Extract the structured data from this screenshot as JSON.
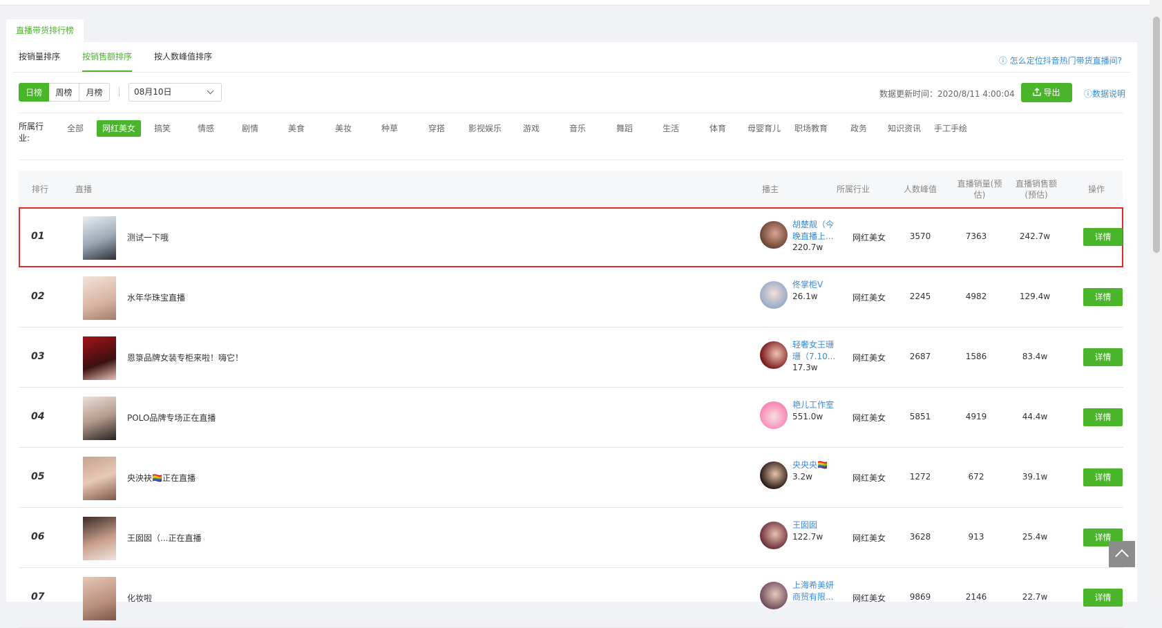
{
  "page_tab": "直播带货排行榜",
  "sort_tabs": [
    "按销量排序",
    "按销售额排序",
    "按人数峰值排序"
  ],
  "help_link": "ⓘ 怎么定位抖音热门带货直播间?",
  "period_buttons": [
    "日榜",
    "周榜",
    "月榜"
  ],
  "date_value": "08月10日",
  "update_time": "数据更新时间：2020/8/11 4:00:04",
  "export_label": "导出",
  "data_desc": "ⓘ数据说明",
  "industry_label": "所属行业:",
  "industries": [
    "全部",
    "网红美女",
    "搞笑",
    "情感",
    "剧情",
    "美食",
    "美妆",
    "种草",
    "穿搭",
    "影视娱乐",
    "游戏",
    "音乐",
    "舞蹈",
    "生活",
    "体育",
    "母婴育儿",
    "职场教育",
    "政务",
    "知识资讯",
    "手工手绘"
  ],
  "active_industry": "网红美女",
  "table_headers": {
    "rank": "排行",
    "live": "直播",
    "anchor": "播主",
    "industry": "所属行业",
    "peak": "人数峰值",
    "sales_volume": "直播销量(预估)",
    "sales_amount": "直播销售额(预估)",
    "action": "操作"
  },
  "detail_label": "详情",
  "rows": [
    {
      "rank": "01",
      "title": "测试一下哦",
      "anchor": "胡楚靓（今晚直播上...",
      "fans": "220.7w",
      "industry": "网红美女",
      "peak": "3570",
      "sales": "7363",
      "amount": "242.7w"
    },
    {
      "rank": "02",
      "title": "水年华珠宝直播",
      "anchor": "佟掌柜V",
      "fans": "26.1w",
      "industry": "网红美女",
      "peak": "2245",
      "sales": "4982",
      "amount": "129.4w"
    },
    {
      "rank": "03",
      "title": "恩箓品牌女装专柜来啦！嗨它！",
      "anchor": "轻奢女王珊珊（7.10...",
      "fans": "17.3w",
      "industry": "网红美女",
      "peak": "2687",
      "sales": "1586",
      "amount": "83.4w"
    },
    {
      "rank": "04",
      "title": "POLO品牌专场正在直播",
      "anchor": "艳儿工作室",
      "fans": "551.0w",
      "industry": "网红美女",
      "peak": "5851",
      "sales": "4919",
      "amount": "44.4w"
    },
    {
      "rank": "05",
      "title": "央泱袂🏳️‍🌈正在直播",
      "anchor": "央央央🏳️‍🌈",
      "fans": "3.2w",
      "industry": "网红美女",
      "peak": "1272",
      "sales": "672",
      "amount": "39.1w"
    },
    {
      "rank": "06",
      "title": "王囡囡（...正在直播",
      "anchor": "王囡囡",
      "fans": "122.7w",
      "industry": "网红美女",
      "peak": "3628",
      "sales": "913",
      "amount": "25.4w"
    },
    {
      "rank": "07",
      "title": "化妆啦",
      "anchor": "上海希美妍商贸有限...",
      "fans": "",
      "industry": "网红美女",
      "peak": "9869",
      "sales": "2146",
      "amount": "22.7w"
    }
  ],
  "colors": {
    "accent": "#4ab42b",
    "link": "#3b8ad9",
    "highlight": "#e52828"
  }
}
